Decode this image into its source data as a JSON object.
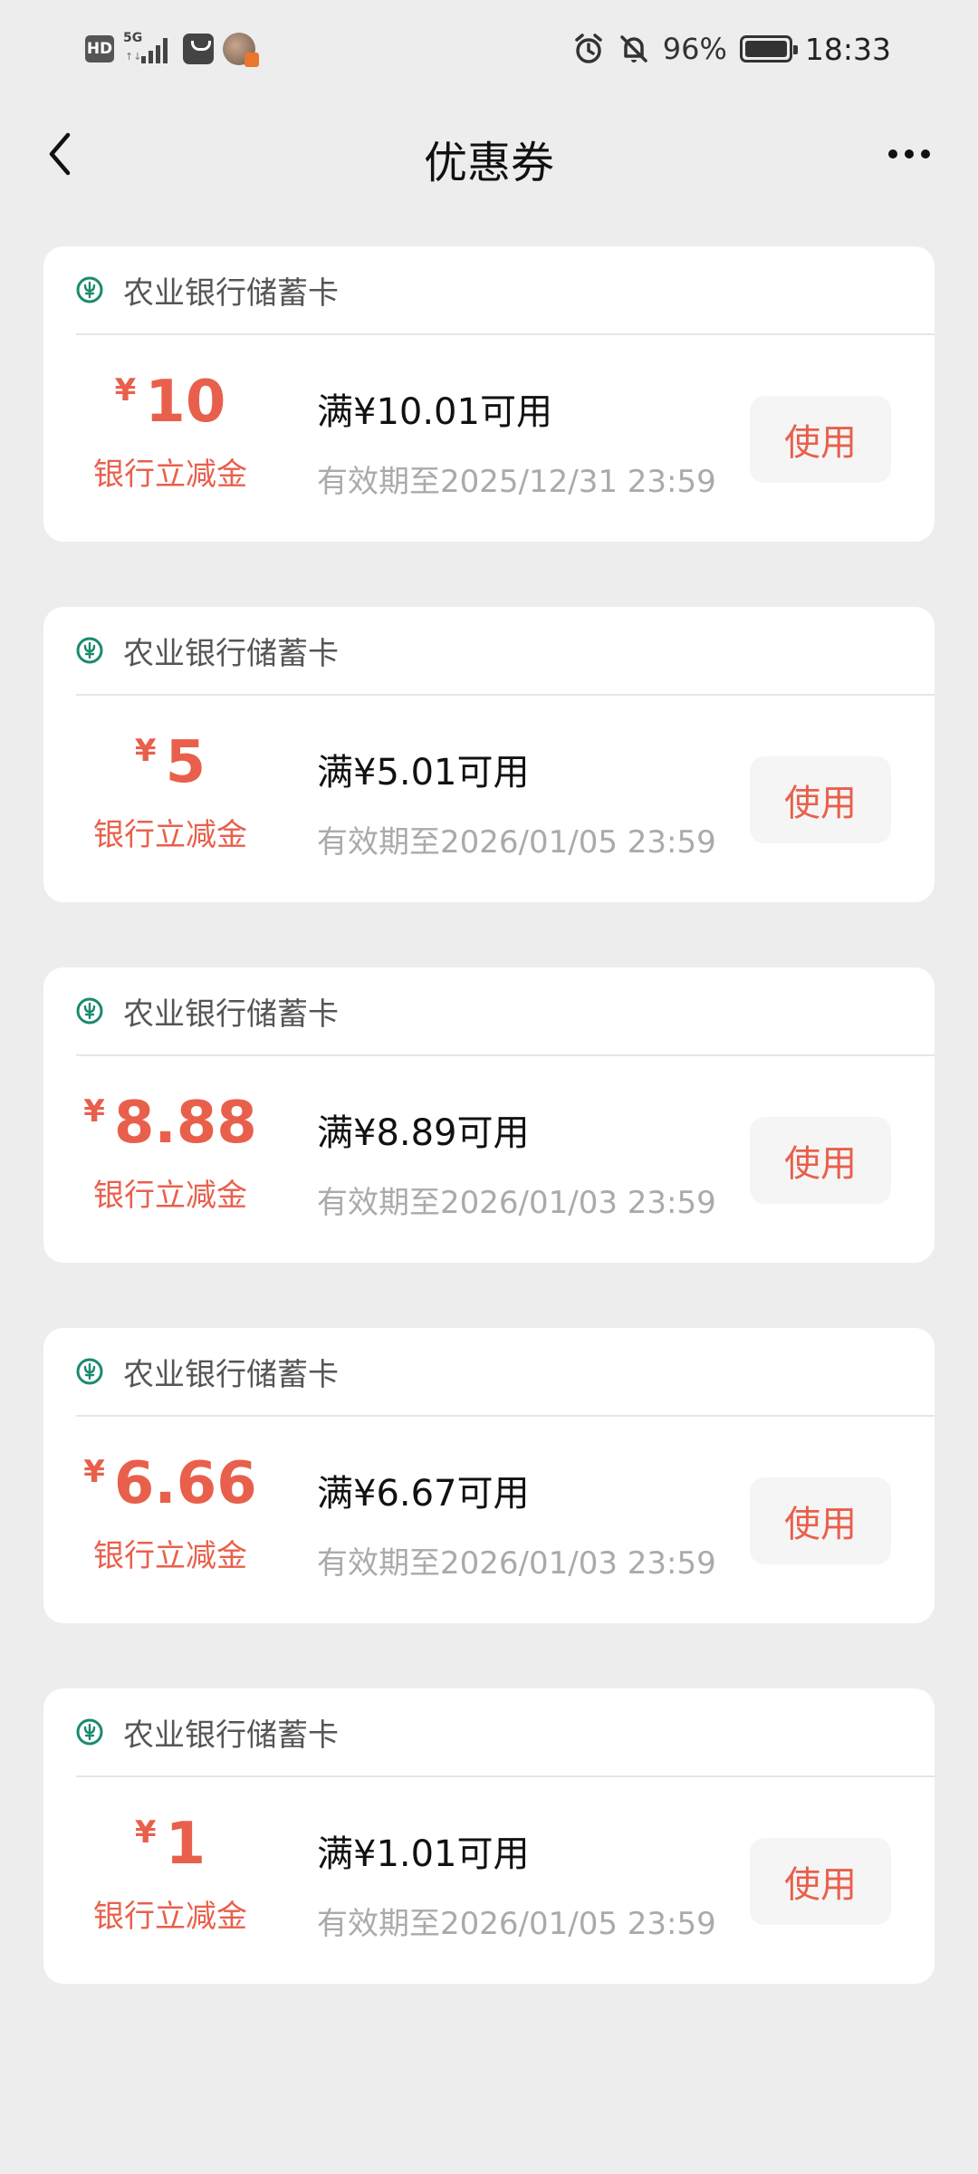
{
  "status_bar": {
    "hd": "HD",
    "network": "5G",
    "battery_pct": "96%",
    "time": "18:33"
  },
  "nav": {
    "title": "优惠券"
  },
  "coupons": [
    {
      "bank": "农业银行储蓄卡",
      "currency": "¥",
      "amount": "10",
      "label": "银行立减金",
      "condition": "满¥10.01可用",
      "expiry": "有效期至2025/12/31 23:59",
      "button": "使用"
    },
    {
      "bank": "农业银行储蓄卡",
      "currency": "¥",
      "amount": "5",
      "label": "银行立减金",
      "condition": "满¥5.01可用",
      "expiry": "有效期至2026/01/05 23:59",
      "button": "使用"
    },
    {
      "bank": "农业银行储蓄卡",
      "currency": "¥",
      "amount": "8.88",
      "label": "银行立减金",
      "condition": "满¥8.89可用",
      "expiry": "有效期至2026/01/03 23:59",
      "button": "使用"
    },
    {
      "bank": "农业银行储蓄卡",
      "currency": "¥",
      "amount": "6.66",
      "label": "银行立减金",
      "condition": "满¥6.67可用",
      "expiry": "有效期至2026/01/03 23:59",
      "button": "使用"
    },
    {
      "bank": "农业银行储蓄卡",
      "currency": "¥",
      "amount": "1",
      "label": "银行立减金",
      "condition": "满¥1.01可用",
      "expiry": "有效期至2026/01/05 23:59",
      "button": "使用"
    }
  ],
  "colors": {
    "accent": "#e8604c",
    "bank_logo": "#1a8a6e",
    "background": "#ededed"
  }
}
